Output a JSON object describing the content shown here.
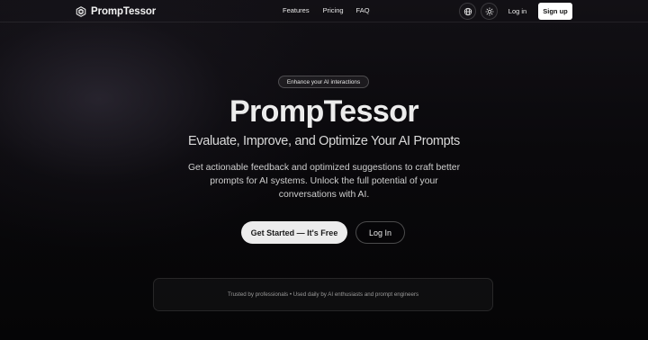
{
  "navbar": {
    "brand": {
      "name": "PrompTessor",
      "logo_icon": "cube-logo-icon"
    },
    "links": [
      {
        "label": "Features"
      },
      {
        "label": "Pricing"
      },
      {
        "label": "FAQ"
      }
    ],
    "language_icon": "globe-icon",
    "theme_icon": "sun-icon",
    "login_label": "Log in",
    "signup_label": "Sign up"
  },
  "hero": {
    "badge": "Enhance your AI interactions",
    "title": "PrompTessor",
    "subtitle": "Evaluate, Improve, and Optimize Your AI Prompts",
    "description": "Get actionable feedback and optimized suggestions to craft better prompts for AI systems. Unlock the full potential of your conversations with AI.",
    "primary_cta": "Get Started — It's Free",
    "secondary_cta": "Log In"
  },
  "trust": {
    "text": "Trusted by professionals • Used daily by AI enthusiasts and prompt engineers"
  },
  "colors": {
    "background": "#0a090c",
    "primary_button": "#ececec",
    "signup_button": "#ffffff",
    "text": "#ffffff"
  }
}
